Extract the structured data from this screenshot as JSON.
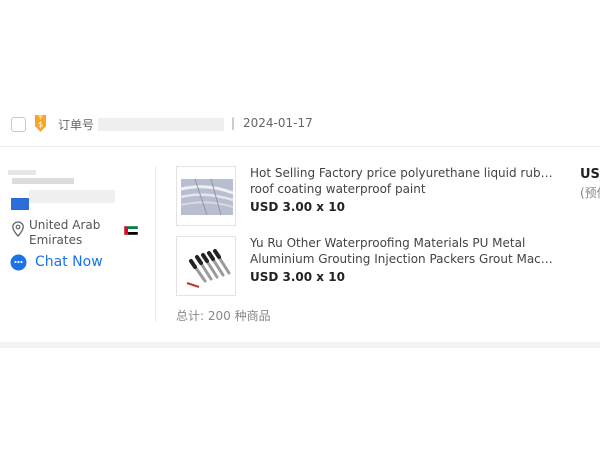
{
  "order": {
    "label": "订单号",
    "separator": "|",
    "date": "2024-01-17"
  },
  "buyer": {
    "location": "United Arab Emirates",
    "chat_label": "Chat Now"
  },
  "products": [
    {
      "title_line1": "Hot Selling Factory price polyurethane liquid rubber",
      "title_line2": "roof coating waterproof paint",
      "price": "USD 3.00 x 10"
    },
    {
      "title_line1": "Yu Ru Other Waterproofing Materials PU Metal",
      "title_line2": "Aluminium Grouting Injection Packers Grout Machin...",
      "price": "USD 3.00 x 10"
    }
  ],
  "total": "总计: 200 种商品",
  "summary": {
    "amount": "US",
    "note": "(预估"
  },
  "colors": {
    "chat_blue": "#1a73e8",
    "medal_gold": "#f5a623"
  },
  "icons": {
    "order_medal": "medal-icon",
    "location": "location-pin-icon",
    "chat": "chat-icon",
    "flag": "uae-flag-icon"
  }
}
